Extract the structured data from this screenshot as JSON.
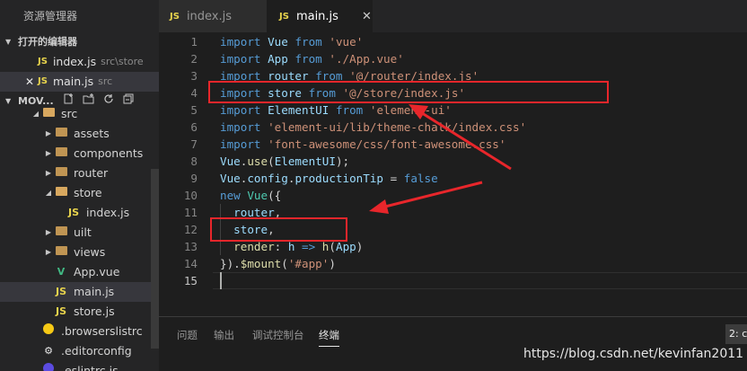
{
  "sidebar": {
    "title": "资源管理器",
    "open_editors_label": "打开的编辑器",
    "open_editors": [
      {
        "badge": "JS",
        "name": "index.js",
        "path": "src\\store",
        "close": "",
        "active": false
      },
      {
        "badge": "JS",
        "name": "main.js",
        "path": "src",
        "close": "✕",
        "active": true
      }
    ],
    "project_label": "MOV...",
    "tree": [
      {
        "name": "src",
        "kind": "folder-open",
        "depth": 1
      },
      {
        "name": "assets",
        "kind": "folder",
        "depth": 2
      },
      {
        "name": "components",
        "kind": "folder",
        "depth": 2
      },
      {
        "name": "router",
        "kind": "folder",
        "depth": 2
      },
      {
        "name": "store",
        "kind": "folder-open",
        "depth": 2
      },
      {
        "name": "index.js",
        "kind": "js",
        "depth": 3
      },
      {
        "name": "uilt",
        "kind": "folder",
        "depth": 2
      },
      {
        "name": "views",
        "kind": "folder",
        "depth": 2
      },
      {
        "name": "App.vue",
        "kind": "vue",
        "depth": 2
      },
      {
        "name": "main.js",
        "kind": "js",
        "depth": 2,
        "selected": true
      },
      {
        "name": "store.js",
        "kind": "js",
        "depth": 2
      },
      {
        "name": ".browserslistrc",
        "kind": "browserslist",
        "depth": 1
      },
      {
        "name": ".editorconfig",
        "kind": "editorconfig",
        "depth": 1
      },
      {
        "name": ".eslintrc.js",
        "kind": "eslint",
        "depth": 1
      }
    ]
  },
  "tabs": [
    {
      "badge": "JS",
      "label": "index.js",
      "active": false
    },
    {
      "badge": "JS",
      "label": "main.js",
      "active": true,
      "close": "✕"
    }
  ],
  "editor": {
    "current_line": 15,
    "lines": [
      {
        "n": "1",
        "tokens": [
          [
            "kw",
            "import"
          ],
          [
            "pl",
            " "
          ],
          [
            "id",
            "Vue"
          ],
          [
            "pl",
            " "
          ],
          [
            "kw",
            "from"
          ],
          [
            "pl",
            " "
          ],
          [
            "str",
            "'vue'"
          ]
        ]
      },
      {
        "n": "2",
        "tokens": [
          [
            "kw",
            "import"
          ],
          [
            "pl",
            " "
          ],
          [
            "id",
            "App"
          ],
          [
            "pl",
            " "
          ],
          [
            "kw",
            "from"
          ],
          [
            "pl",
            " "
          ],
          [
            "str",
            "'./App.vue'"
          ]
        ]
      },
      {
        "n": "3",
        "tokens": [
          [
            "kw",
            "import"
          ],
          [
            "pl",
            " "
          ],
          [
            "id",
            "router"
          ],
          [
            "pl",
            " "
          ],
          [
            "kw",
            "from"
          ],
          [
            "pl",
            " "
          ],
          [
            "str",
            "'@/router/index.js'"
          ]
        ]
      },
      {
        "n": "4",
        "tokens": [
          [
            "kw",
            "import"
          ],
          [
            "pl",
            " "
          ],
          [
            "id",
            "store"
          ],
          [
            "pl",
            " "
          ],
          [
            "kw",
            "from"
          ],
          [
            "pl",
            " "
          ],
          [
            "str",
            "'@/store/index.js'"
          ]
        ]
      },
      {
        "n": "5",
        "tokens": [
          [
            "kw",
            "import"
          ],
          [
            "pl",
            " "
          ],
          [
            "id",
            "ElementUI"
          ],
          [
            "pl",
            " "
          ],
          [
            "kw",
            "from"
          ],
          [
            "pl",
            " "
          ],
          [
            "str",
            "'element-ui'"
          ]
        ]
      },
      {
        "n": "6",
        "tokens": [
          [
            "kw",
            "import"
          ],
          [
            "pl",
            " "
          ],
          [
            "str",
            "'element-ui/lib/theme-chalk/index.css'"
          ]
        ]
      },
      {
        "n": "7",
        "tokens": [
          [
            "kw",
            "import"
          ],
          [
            "pl",
            " "
          ],
          [
            "str",
            "'font-awesome/css/font-awesome.css'"
          ]
        ]
      },
      {
        "n": "8",
        "tokens": [
          [
            "id",
            "Vue"
          ],
          [
            "pl",
            "."
          ],
          [
            "fn",
            "use"
          ],
          [
            "pl",
            "("
          ],
          [
            "id",
            "ElementUI"
          ],
          [
            "pl",
            ");"
          ]
        ]
      },
      {
        "n": "9",
        "tokens": [
          [
            "id",
            "Vue"
          ],
          [
            "pl",
            "."
          ],
          [
            "id",
            "config"
          ],
          [
            "pl",
            "."
          ],
          [
            "id",
            "productionTip"
          ],
          [
            "pl",
            " = "
          ],
          [
            "kw",
            "false"
          ]
        ]
      },
      {
        "n": "10",
        "tokens": [
          [
            "kw",
            "new"
          ],
          [
            "pl",
            " "
          ],
          [
            "cls",
            "Vue"
          ],
          [
            "pl",
            "({"
          ]
        ]
      },
      {
        "n": "11",
        "tokens": [
          [
            "pl",
            "  "
          ],
          [
            "id",
            "router"
          ],
          [
            "pl",
            ","
          ]
        ]
      },
      {
        "n": "12",
        "tokens": [
          [
            "pl",
            "  "
          ],
          [
            "id",
            "store"
          ],
          [
            "pl",
            ","
          ]
        ]
      },
      {
        "n": "13",
        "tokens": [
          [
            "pl",
            "  "
          ],
          [
            "fn",
            "render"
          ],
          [
            "pl",
            ": "
          ],
          [
            "id",
            "h"
          ],
          [
            "pl",
            " "
          ],
          [
            "kw",
            "=>"
          ],
          [
            "pl",
            " "
          ],
          [
            "fn",
            "h"
          ],
          [
            "pl",
            "("
          ],
          [
            "id",
            "App"
          ],
          [
            "pl",
            ")"
          ]
        ]
      },
      {
        "n": "14",
        "tokens": [
          [
            "pl",
            "})."
          ],
          [
            "fn",
            "$mount"
          ],
          [
            "pl",
            "("
          ],
          [
            "str",
            "'#app'"
          ],
          [
            "pl",
            ")"
          ]
        ]
      },
      {
        "n": "15",
        "tokens": []
      }
    ]
  },
  "panel": {
    "tabs": [
      "问题",
      "输出",
      "调试控制台",
      "终端"
    ],
    "active_tab": "终端",
    "terminal_select": "2: c"
  },
  "watermark": "https://blog.csdn.net/kevinfan2011",
  "colors": {
    "annotation_red": "#e8262b",
    "js_badge": "#e8d44d",
    "vue_green": "#41b883",
    "folder": "#c09553"
  }
}
